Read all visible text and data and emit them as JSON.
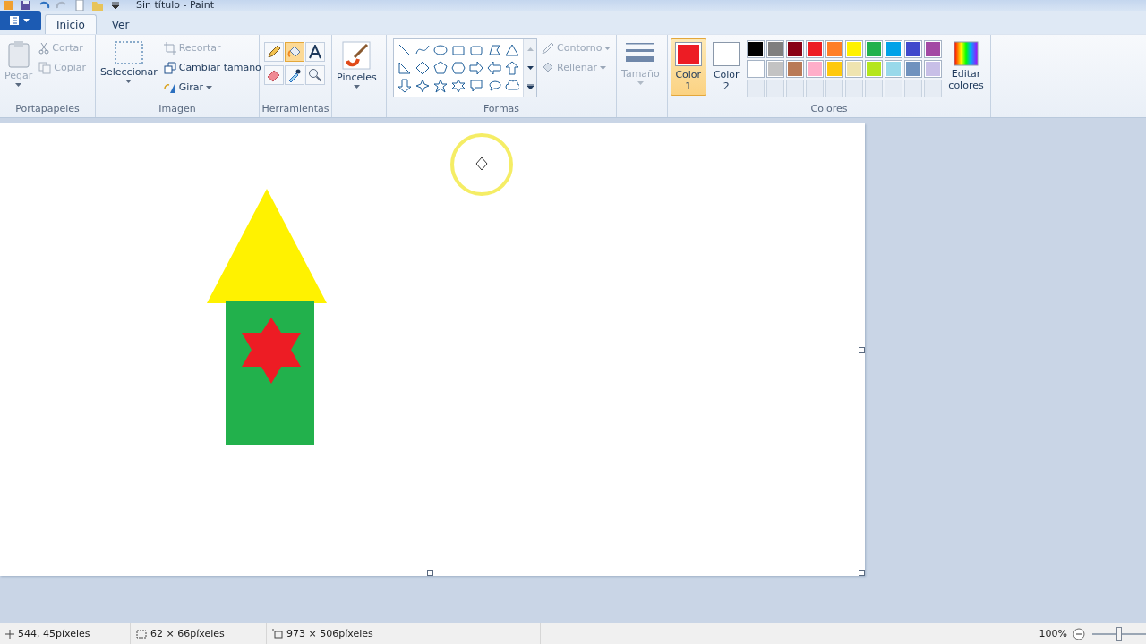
{
  "window": {
    "title": "Sin título - Paint"
  },
  "tabs": [
    {
      "label": "Inicio",
      "selected": true
    },
    {
      "label": "Ver",
      "selected": false
    }
  ],
  "ribbon": {
    "portapapeles": {
      "title": "Portapapeles",
      "paste": "Pegar",
      "items": [
        {
          "label": "Cortar",
          "kind": "cut",
          "disabled": true
        },
        {
          "label": "Copiar",
          "kind": "copy",
          "disabled": true
        }
      ]
    },
    "imagen": {
      "title": "Imagen",
      "select": "Seleccionar",
      "items": [
        {
          "label": "Recortar",
          "kind": "crop",
          "disabled": true
        },
        {
          "label": "Cambiar tamaño",
          "kind": "resize",
          "disabled": false
        },
        {
          "label": "Girar",
          "kind": "rotate",
          "disabled": false
        }
      ]
    },
    "herramientas": {
      "title": "Herramientas",
      "tools": [
        {
          "kind": "pencil",
          "selected": false
        },
        {
          "kind": "fill",
          "selected": true
        },
        {
          "kind": "text",
          "selected": false
        },
        {
          "kind": "eraser",
          "selected": false
        },
        {
          "kind": "picker",
          "selected": false
        },
        {
          "kind": "magnifier",
          "selected": false
        }
      ]
    },
    "pinceles": {
      "label": "Pinceles"
    },
    "formas": {
      "title": "Formas",
      "shapes": [
        {
          "kind": "line"
        },
        {
          "kind": "curve"
        },
        {
          "kind": "oval"
        },
        {
          "kind": "rect"
        },
        {
          "kind": "roundrect"
        },
        {
          "kind": "polygon"
        },
        {
          "kind": "triangle"
        },
        {
          "kind": "righttriangle"
        },
        {
          "kind": "diamond"
        },
        {
          "kind": "pentagon"
        },
        {
          "kind": "hexagon"
        },
        {
          "kind": "arrowright"
        },
        {
          "kind": "arrowleft"
        },
        {
          "kind": "arrowup"
        },
        {
          "kind": "arrowdown"
        },
        {
          "kind": "star4"
        },
        {
          "kind": "star5"
        },
        {
          "kind": "star6"
        },
        {
          "kind": "callout"
        },
        {
          "kind": "calloutoval"
        },
        {
          "kind": "cloud"
        }
      ],
      "outline": {
        "label": "Contorno",
        "disabled": true
      },
      "fill": {
        "label": "Rellenar",
        "disabled": true
      }
    },
    "tamano": {
      "label": "Tamaño",
      "disabled": true
    },
    "colores": {
      "title": "Colores",
      "slots": [
        {
          "label": "Color 1",
          "color": "#ed1c24",
          "selected": true
        },
        {
          "label": "Color 2",
          "color": "#ffffff",
          "selected": false
        }
      ],
      "palette": [
        {
          "color": "#000000"
        },
        {
          "color": "#7f7f7f"
        },
        {
          "color": "#880015"
        },
        {
          "color": "#ed1c24"
        },
        {
          "color": "#ff7f27"
        },
        {
          "color": "#fff200"
        },
        {
          "color": "#22b14c"
        },
        {
          "color": "#00a2e8"
        },
        {
          "color": "#3f48cc"
        },
        {
          "color": "#a349a4"
        },
        {
          "color": "#ffffff"
        },
        {
          "color": "#c3c3c3"
        },
        {
          "color": "#b97a57"
        },
        {
          "color": "#ffaec9"
        },
        {
          "color": "#ffc90e"
        },
        {
          "color": "#efe4b0"
        },
        {
          "color": "#b5e61d"
        },
        {
          "color": "#99d9ea"
        },
        {
          "color": "#7092be"
        },
        {
          "color": "#c8bfe7"
        }
      ],
      "edit": "Editar colores"
    }
  },
  "status_bar": {
    "cursor": "544, 45píxeles",
    "selection": "62 × 66píxeles",
    "size": "973 × 506píxeles",
    "zoom": "100%",
    "level": 0.5
  }
}
